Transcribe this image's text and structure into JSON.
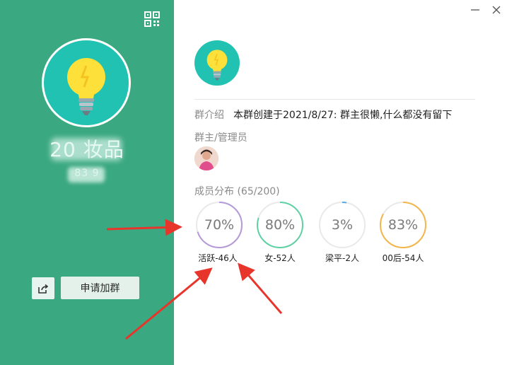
{
  "left_panel": {
    "group_name": "20 妆品",
    "group_id": "83 9",
    "share_icon": "share-icon",
    "join_button": "申请加群",
    "qr_icon": "qr-code-icon"
  },
  "window": {
    "minimize_icon": "minimize-icon",
    "close_icon": "close-icon"
  },
  "info": {
    "intro_label": "群介绍",
    "intro_text": "本群创建于2021/8/27: 群主很懒,什么都没有留下",
    "admin_label": "群主/管理员",
    "distribution_label": "成员分布 (65/200)"
  },
  "stats": [
    {
      "percent": "70%",
      "value": 70,
      "label": "活跃-46人",
      "color": "#b49ad8"
    },
    {
      "percent": "80%",
      "value": 80,
      "label": "女-52人",
      "color": "#5fd1a4"
    },
    {
      "percent": "3%",
      "value": 3,
      "label": "梁平-2人",
      "color": "#5aa9e6"
    },
    {
      "percent": "83%",
      "value": 83,
      "label": "00后-54人",
      "color": "#f4b64c"
    }
  ],
  "colors": {
    "sidebar": "#3aa881",
    "avatar_bg": "#22c2b3",
    "annotation_arrow": "#e8352b"
  }
}
